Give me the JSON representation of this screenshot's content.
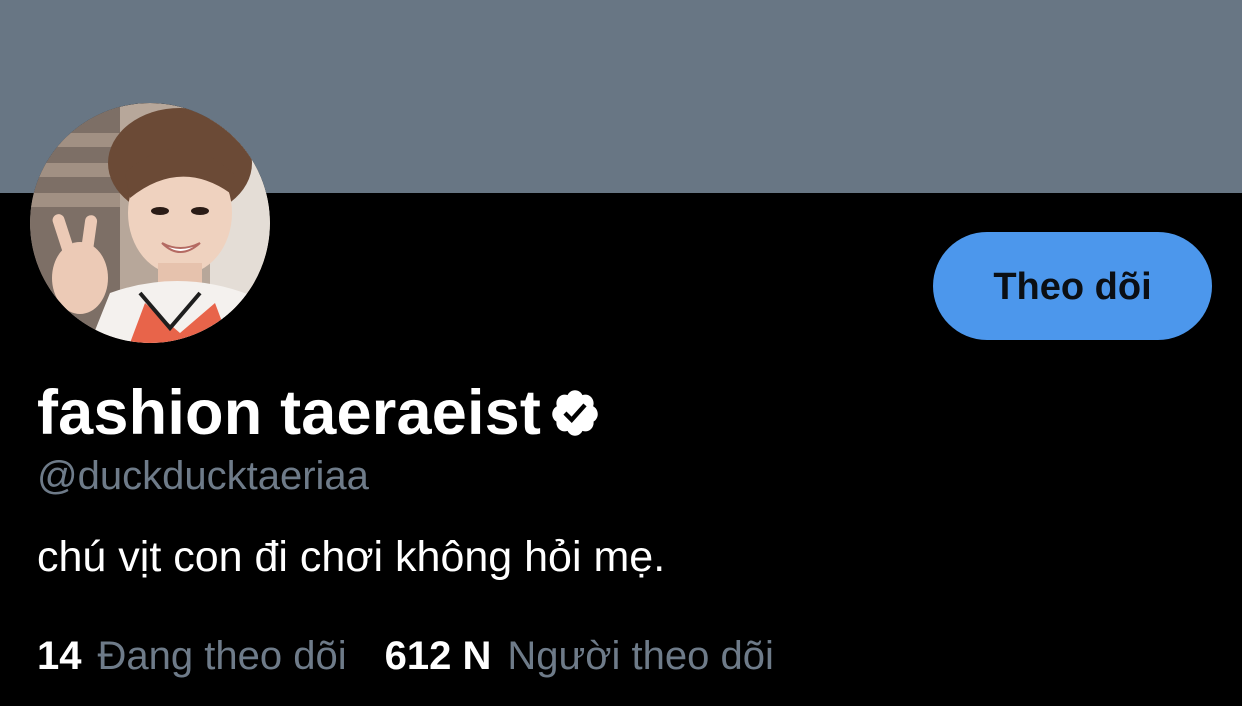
{
  "profile": {
    "display_name": "fashion taeraeist",
    "handle": "@duckducktaeriaa",
    "bio": "chú vịt con đi chơi không hỏi mẹ.",
    "verified": true
  },
  "actions": {
    "follow_label": "Theo dõi"
  },
  "stats": {
    "following_count": "14",
    "following_label": "Đang theo dõi",
    "followers_count": "612 N",
    "followers_label": "Người theo dõi"
  },
  "colors": {
    "banner": "#687684",
    "background": "#000000",
    "follow_button": "#4c97ec",
    "secondary_text": "#6e7b89"
  },
  "icons": {
    "verified": "verified-badge-icon",
    "avatar": "profile-photo"
  }
}
